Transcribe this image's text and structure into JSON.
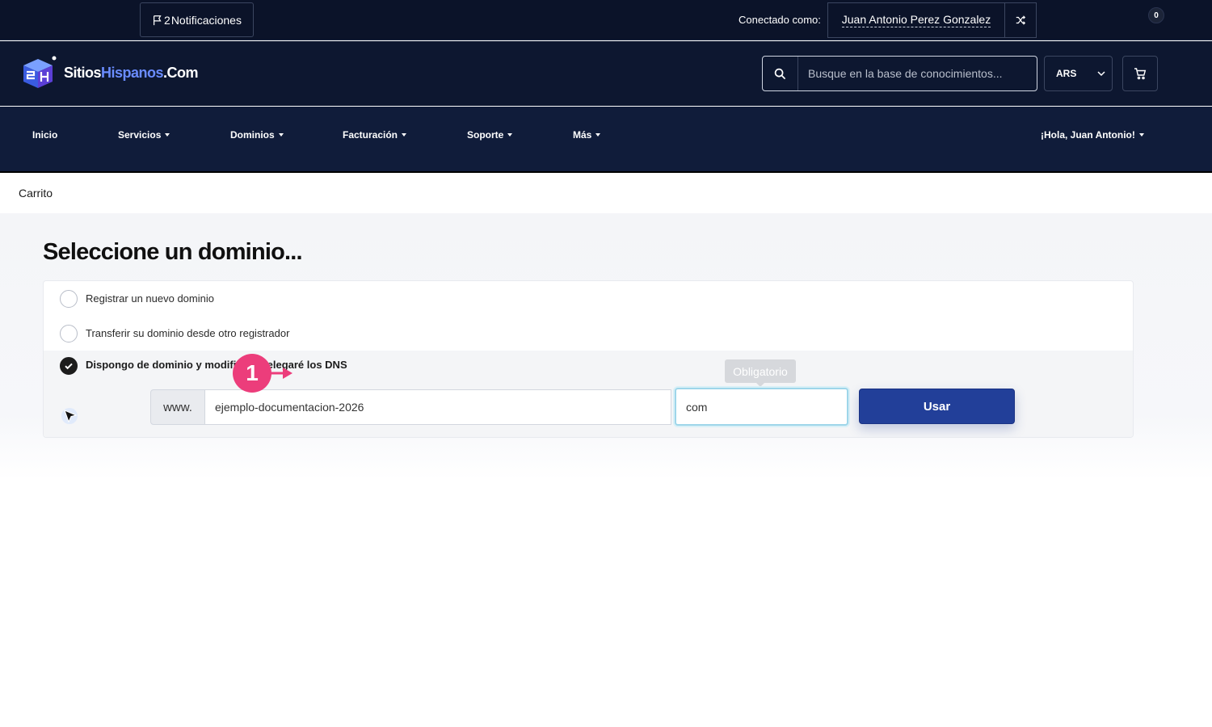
{
  "topbar": {
    "notifications_count": "2",
    "notifications_label": "Notificaciones",
    "connected_label": "Conectado como:",
    "user_name": "Juan Antonio Perez Gonzalez"
  },
  "header": {
    "logo_white": "Sitios",
    "logo_blue": "Hispanos",
    "logo_suffix": ".Com",
    "search_placeholder": "Busque en la base de conocimientos...",
    "currency": "ARS",
    "cart_count": "0"
  },
  "nav": {
    "items": [
      {
        "label": "Inicio"
      },
      {
        "label": "Servicios"
      },
      {
        "label": "Dominios"
      },
      {
        "label": "Facturación"
      },
      {
        "label": "Soporte"
      },
      {
        "label": "Más"
      }
    ],
    "greeting": "¡Hola, Juan Antonio!"
  },
  "breadcrumb": "Carrito",
  "main": {
    "title": "Seleccione un dominio...",
    "options": [
      {
        "label": "Registrar un nuevo dominio",
        "selected": false
      },
      {
        "label": "Transferir su dominio desde otro registrador",
        "selected": false
      },
      {
        "label": "Dispongo de dominio y modificaré/delegaré los DNS",
        "selected": true
      }
    ],
    "www_prefix": "www.",
    "domain_value": "ejemplo-documentacion-2026",
    "tld_value": "com",
    "tooltip": "Obligatorio",
    "use_button": "Usar"
  },
  "overlay": {
    "step_number": "1"
  },
  "colors": {
    "topbar_bg": "#0b1329",
    "nav_bg": "#101c3a",
    "brand_blue": "#6a8cff",
    "primary_button": "#223f99",
    "step_badge": "#ec3d7b"
  }
}
